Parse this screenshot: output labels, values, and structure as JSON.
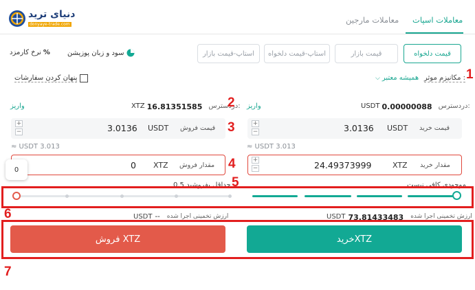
{
  "logo": {
    "name": "دنیای ترید",
    "url": "donyaye-trade.com",
    "accent": "#f0a500"
  },
  "tabs": [
    {
      "label": "معاملات اسپات",
      "active": true
    },
    {
      "label": "معاملات مارجین",
      "active": false
    }
  ],
  "order_types": [
    "قیمت دلخواه",
    "قیمت بازار",
    "استاپ-قیمت دلخواه",
    "استاپ-قیمت بازار"
  ],
  "side_options": {
    "pnl_label": "سود و زبان پوزیشن",
    "fee_label": "نرخ کارمزد"
  },
  "mechanism": {
    "label": "مکانیزم موثر :",
    "value": "همیشه معتبر"
  },
  "hide_orders": {
    "label": "پنهان کردن سفارشات",
    "checked": false
  },
  "buy": {
    "available_label": "دردسترس:",
    "available_value": "0.00000088",
    "available_unit": "USDT",
    "deposit": "واریز",
    "price_label": "قیمت خرید",
    "price_unit": "USDT",
    "price_value": "3.0136",
    "approx": "≈ USDT 3.013",
    "amount_label": "مقدار خرید",
    "amount_unit": "XTZ",
    "amount_value": "24.49373999",
    "insufficient": "موجودی کافی نیست",
    "est_label": "ارزش تخمینی اجرا شده",
    "est_value": "73.81433483",
    "est_unit": "USDT",
    "button": "خریدXTZ",
    "slider_level": 1.0,
    "color": "#12a994"
  },
  "sell": {
    "available_label": "دردسترس:",
    "available_value": "16.81351585",
    "available_unit": "XTZ",
    "deposit": "واریز",
    "price_label": "قیمت فروش",
    "price_unit": "USDT",
    "price_value": "3.0136",
    "approx": "≈ USDT 3.013",
    "amount_label": "مقدار فروش",
    "amount_unit": "XTZ",
    "amount_value": "0",
    "min_label": "حداقل بفروشید 0.5",
    "est_label": "ارزش تخمینی اجرا شده",
    "est_value": "--",
    "est_unit": "USDT",
    "button": "فروش XTZ",
    "slider_level": 0,
    "color": "#e35a4a"
  },
  "percent_badge": "0",
  "annotations": [
    "1",
    "2",
    "3",
    "4",
    "5",
    "6",
    "7"
  ]
}
